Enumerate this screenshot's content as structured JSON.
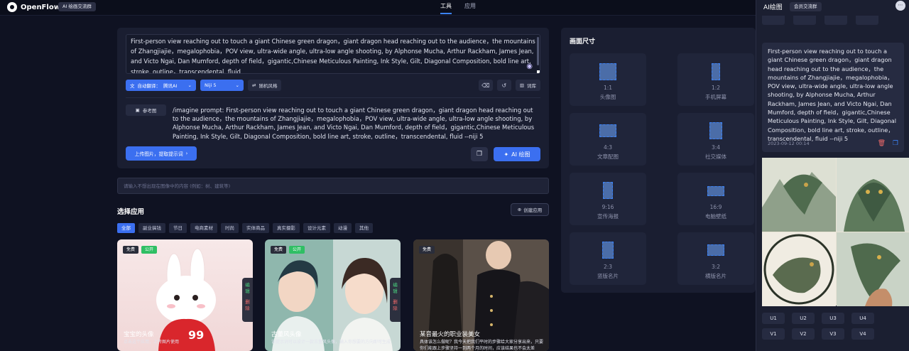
{
  "header": {
    "brand": "OpenFlow",
    "group_badge": "AI 绘画交流群",
    "nav": [
      {
        "label": "工具",
        "active": true
      },
      {
        "label": "应用",
        "active": false
      }
    ]
  },
  "prompt": {
    "text": "First-person view reaching out to touch a giant Chinese green dragon，giant dragon head reaching out to the audience，the mountains of Zhangjiajie，megalophobia，POV view, ultra-wide angle, ultra-low angle shooting, by Alphonse Mucha, Arthur Rackham, James Jean, and Victo Ngai, Dan Mumford, depth of field，gigantic,Chinese Meticulous Painting, Ink Style, Gilt, Diagonal Composition, bold line art, stroke, outline，transcendental, fluid",
    "translate_label": "自动翻译：",
    "translate_value": "腾讯AI",
    "model_value": "Niji 5",
    "random_style": "随机风格",
    "dictionary": "词库",
    "reference_image": "参考图",
    "imagine_text": "/imagine prompt:  First-person view reaching out to touch a giant Chinese green dragon，giant dragon head reaching out to the audience，the mountains of Zhangjiajie，megalophobia，POV view, ultra-wide angle, ultra-low angle shooting, by Alphonse Mucha, Arthur Rackham, James Jean, and Victo Ngai, Dan Mumford, depth of field，gigantic,Chinese Meticulous Painting, Ink Style, Gilt, Diagonal Composition, bold line art, stroke, outline，transcendental, fluid --niji 5",
    "upload_button": "上传图片，提取提示词",
    "draw_button": "AI 绘图"
  },
  "negative": {
    "placeholder": "请输入不想出现在图像中的内容 (例如：树、建筑等)"
  },
  "apps": {
    "title": "选择应用",
    "create_button": "创建应用",
    "filters": [
      {
        "label": "全部",
        "active": true
      },
      {
        "label": "副业搞钱",
        "active": false
      },
      {
        "label": "节日",
        "active": false
      },
      {
        "label": "电商素材",
        "active": false
      },
      {
        "label": "时尚",
        "active": false
      },
      {
        "label": "实体商品",
        "active": false
      },
      {
        "label": "真实摄影",
        "active": false
      },
      {
        "label": "设计元素",
        "active": false
      },
      {
        "label": "动漫",
        "active": false
      },
      {
        "label": "其他",
        "active": false
      }
    ],
    "cards": [
      {
        "title": "宝宝的头像",
        "desc": "点击这个应用，上传图片使用",
        "free": "免费",
        "public": "公开",
        "edit": "编辑",
        "delete": "删除"
      },
      {
        "title": "古董风头像",
        "desc": "该提示词可以设计一款古董风头像，输入你想要的方向即可生成",
        "free": "免费",
        "public": "公开",
        "edit": "编辑",
        "delete": "删除"
      },
      {
        "title": "某音最火的职业装美女",
        "desc": "具体该怎么做呢？我今天把我们平时的步骤给大家分享出来，只要你们能跟上步骤坚持一到两个月的时间，应该结果也不会太差",
        "free": "免费"
      }
    ]
  },
  "sizes": {
    "title": "画面尺寸",
    "items": [
      {
        "ratio": "1:1",
        "name": "头像图"
      },
      {
        "ratio": "1:2",
        "name": "手机屏幕"
      },
      {
        "ratio": "4:3",
        "name": "文章配图"
      },
      {
        "ratio": "3:4",
        "name": "社交媒体"
      },
      {
        "ratio": "9:16",
        "name": "宣传海报"
      },
      {
        "ratio": "16:9",
        "name": "电脑壁纸"
      },
      {
        "ratio": "2:3",
        "name": "竖版名片"
      },
      {
        "ratio": "3:2",
        "name": "横版名片"
      }
    ]
  },
  "right_panel": {
    "title": "AI绘图",
    "member_group": "会员交流群",
    "message": "First-person view reaching out to touch a giant Chinese green dragon，giant dragon head reaching out to the audience，the mountains of Zhangjiajie，megalophobia，POV view, ultra-wide angle, ultra-low angle shooting, by Alphonse Mucha, Arthur Rackham, James Jean, and Victo Ngai, Dan Mumford, depth of field，gigantic,Chinese Meticulous Painting, Ink Style, Gilt, Diagonal Composition, bold line art, stroke, outline，transcendental, fluid --niji 5",
    "timestamp": "2023-09-12 00:14",
    "upscale": [
      "U1",
      "U2",
      "U3",
      "U4"
    ],
    "variation": [
      "V1",
      "V2",
      "V3",
      "V4"
    ]
  }
}
